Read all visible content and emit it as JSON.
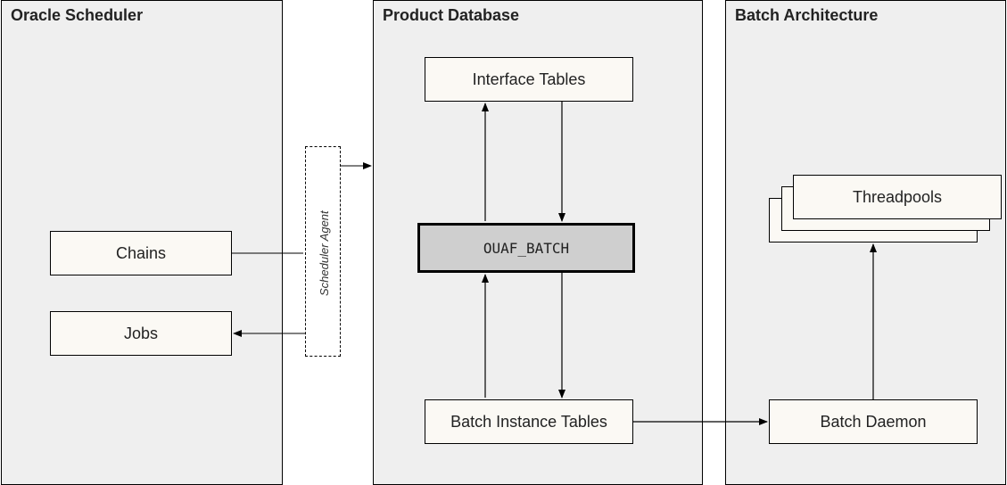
{
  "panels": {
    "oracle_scheduler": {
      "title": "Oracle Scheduler"
    },
    "product_database": {
      "title": "Product Database"
    },
    "batch_architecture": {
      "title": "Batch Architecture"
    }
  },
  "boxes": {
    "chains": "Chains",
    "jobs": "Jobs",
    "interface_tables": "Interface Tables",
    "ouaf_batch": "OUAF_BATCH",
    "batch_instance_tables": "Batch Instance Tables",
    "threadpools": "Threadpools",
    "batch_daemon": "Batch Daemon"
  },
  "labels": {
    "scheduler_agent": "Scheduler Agent"
  }
}
